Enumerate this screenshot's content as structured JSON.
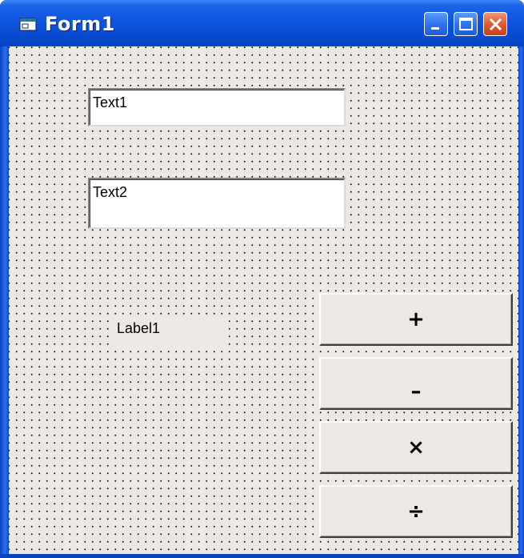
{
  "window": {
    "title": "Form1",
    "colors": {
      "titlebar": "#0a4bd2",
      "client": "#ece9e4",
      "close": "#e0552b"
    }
  },
  "controls": {
    "text1": {
      "value": "Text1"
    },
    "text2": {
      "value": "Text2"
    },
    "label1": {
      "text": "Label1"
    },
    "buttons": [
      {
        "label": "+"
      },
      {
        "label": "–"
      },
      {
        "label": "×"
      },
      {
        "label": "÷"
      }
    ]
  },
  "icons": {
    "app": "form-icon",
    "minimize": "minimize-icon",
    "maximize": "maximize-icon",
    "close": "close-icon"
  }
}
